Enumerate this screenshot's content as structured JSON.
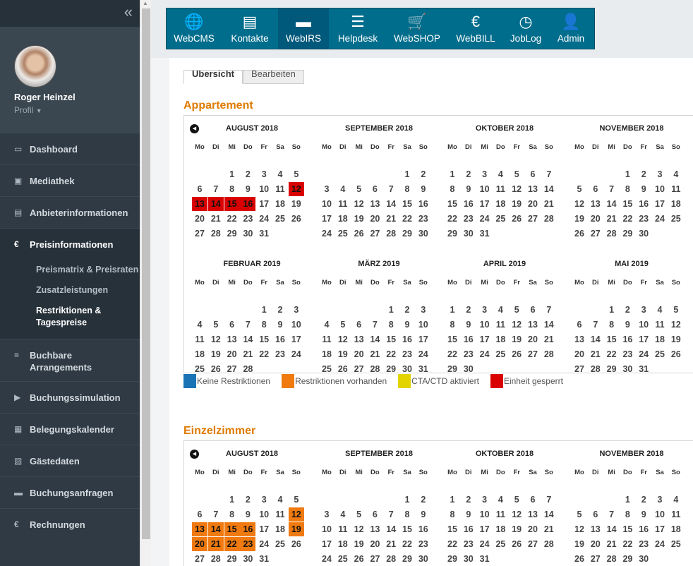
{
  "sidebar": {
    "collapse_icon": "double-chevron-left-icon",
    "user_name": "Roger Heinzel",
    "profile_label": "Profil",
    "nav": [
      {
        "label": "Dashboard",
        "icon": "monitor-icon",
        "glyph": "▭"
      },
      {
        "label": "Mediathek",
        "icon": "image-icon",
        "glyph": "▣"
      },
      {
        "label": "Anbieterinformationen",
        "icon": "id-card-icon",
        "glyph": "▤"
      },
      {
        "label": "Preisinformationen",
        "icon": "euro-icon",
        "glyph": "€",
        "active": true,
        "sub": [
          {
            "label": "Preismatrix & Preisraten"
          },
          {
            "label": "Zusatzleistungen"
          },
          {
            "label": "Restriktionen & Tagespreise",
            "active": true
          }
        ]
      },
      {
        "label": "Buchbare Arrangements",
        "icon": "list-icon",
        "glyph": "≡",
        "double": true
      },
      {
        "label": "Buchungssimulation",
        "icon": "play-circle-icon",
        "glyph": "▶"
      },
      {
        "label": "Belegungskalender",
        "icon": "calendar-icon",
        "glyph": "▦"
      },
      {
        "label": "Gästedaten",
        "icon": "contact-book-icon",
        "glyph": "▧"
      },
      {
        "label": "Buchungsanfragen",
        "icon": "bed-icon",
        "glyph": "▬"
      },
      {
        "label": "Rechnungen",
        "icon": "euro-icon",
        "glyph": "€"
      }
    ]
  },
  "topnav": [
    {
      "label": "WebCMS",
      "icon": "globe-icon",
      "glyph": "🌐"
    },
    {
      "label": "Kontakte",
      "icon": "contact-card-icon",
      "glyph": "▤"
    },
    {
      "label": "WebIRS",
      "icon": "bed-icon",
      "glyph": "▬",
      "active": true
    },
    {
      "label": "Helpdesk",
      "icon": "list-icon",
      "glyph": "☰"
    },
    {
      "label": "WebSHOP",
      "icon": "cart-icon",
      "glyph": "🛒"
    },
    {
      "label": "WebBILL",
      "icon": "euro-icon",
      "glyph": "€"
    },
    {
      "label": "JobLog",
      "icon": "clock-icon",
      "glyph": "◷"
    },
    {
      "label": "Admin",
      "icon": "user-icon",
      "glyph": "👤"
    }
  ],
  "tabs": [
    {
      "label": "Übersicht",
      "active": true
    },
    {
      "label": "Bearbeiten",
      "active": false
    }
  ],
  "weekday_headers": [
    "Mo",
    "Di",
    "Mi",
    "Do",
    "Fr",
    "Sa",
    "So"
  ],
  "prev_icon": "arrow-left-circle-icon",
  "sections": [
    {
      "title": "Appartement",
      "legend": [
        {
          "label": "Keine Restriktionen",
          "color": "#1a73b5"
        },
        {
          "label": "Restriktionen vorhanden",
          "color": "#f07a0f"
        },
        {
          "label": "CTA/CTD aktiviert",
          "color": "#e3d400"
        },
        {
          "label": "Einheit gesperrt",
          "color": "#d90000"
        }
      ],
      "months": [
        {
          "name": "AUGUST 2018",
          "offset": 2,
          "days": 31,
          "marked": {
            "12": "blocked",
            "13": "blocked",
            "14": "blocked",
            "15": "blocked",
            "16": "blocked"
          }
        },
        {
          "name": "SEPTEMBER 2018",
          "offset": 5,
          "days": 30,
          "marked": {}
        },
        {
          "name": "OKTOBER 2018",
          "offset": 0,
          "days": 31,
          "marked": {}
        },
        {
          "name": "NOVEMBER 2018",
          "offset": 3,
          "days": 30,
          "marked": {}
        },
        {
          "name": "FEBRUAR 2019",
          "offset": 4,
          "days": 28,
          "marked": {}
        },
        {
          "name": "MÄRZ 2019",
          "offset": 4,
          "days": 31,
          "marked": {}
        },
        {
          "name": "APRIL 2019",
          "offset": 0,
          "days": 30,
          "marked": {}
        },
        {
          "name": "MAI 2019",
          "offset": 2,
          "days": 31,
          "marked": {}
        }
      ]
    },
    {
      "title": "Einzelzimmer",
      "months": [
        {
          "name": "AUGUST 2018",
          "offset": 2,
          "days": 31,
          "marked": {
            "12": "restricted",
            "13": "restricted",
            "14": "restricted",
            "15": "restricted",
            "16": "restricted",
            "19": "restricted",
            "20": "restricted",
            "21": "restricted",
            "22": "restricted",
            "23": "restricted"
          }
        },
        {
          "name": "SEPTEMBER 2018",
          "offset": 5,
          "days": 30,
          "marked": {}
        },
        {
          "name": "OKTOBER 2018",
          "offset": 0,
          "days": 31,
          "marked": {}
        },
        {
          "name": "NOVEMBER 2018",
          "offset": 3,
          "days": 30,
          "marked": {}
        }
      ]
    }
  ]
}
